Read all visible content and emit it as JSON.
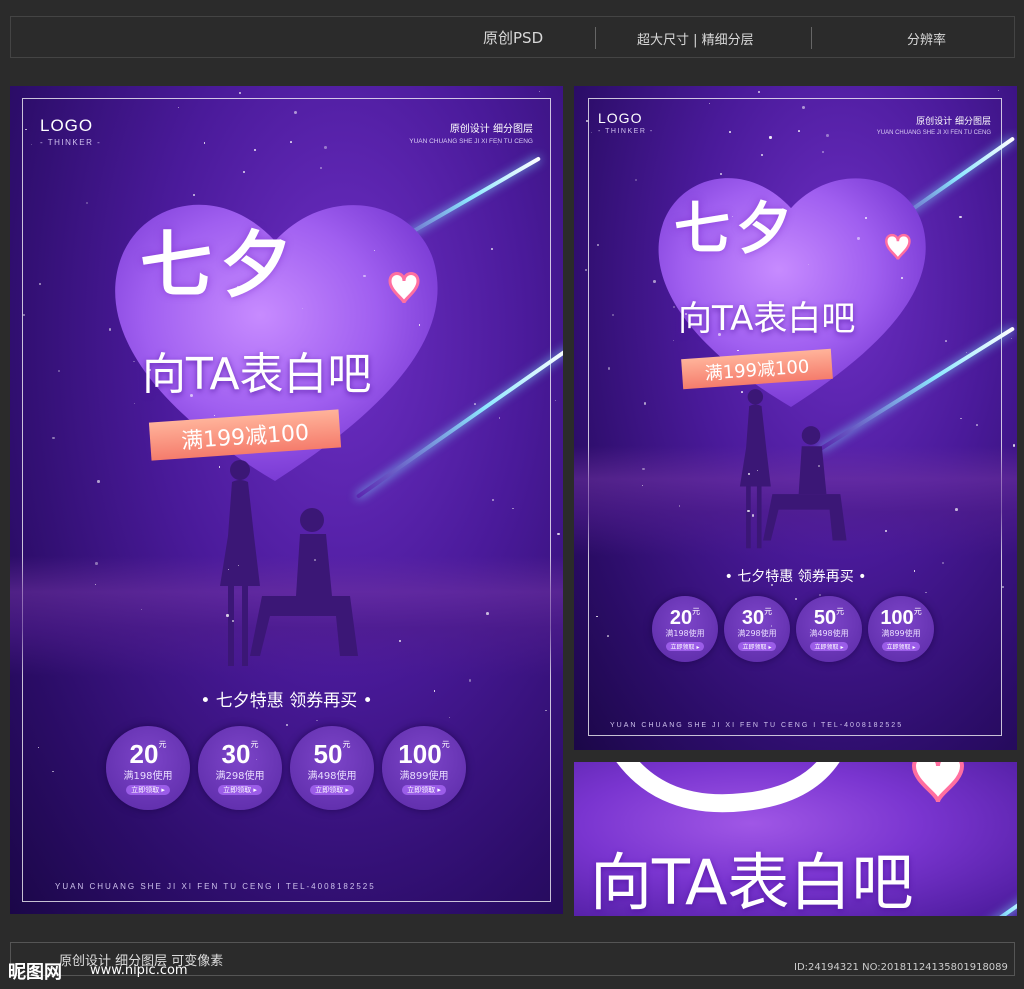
{
  "topbar": {
    "psd": "原创PSD",
    "size": "超大尺寸 | 精细分层",
    "res": "分辨率"
  },
  "poster": {
    "logo": "LOGO",
    "logo_sub": "- THINKER -",
    "tag_cn": "原创设计 细分图层",
    "tag_en": "YUAN CHUANG SHE JI XI FEN TU CENG",
    "title": "七夕",
    "subtitle": "向TA表白吧",
    "ribbon": "满199减100",
    "promo": "• 七夕特惠  领券再买 •",
    "coupons": [
      {
        "value": "20",
        "unit": "元",
        "cond": "满198使用",
        "btn": "立即领取 ▸"
      },
      {
        "value": "30",
        "unit": "元",
        "cond": "满298使用",
        "btn": "立即领取 ▸"
      },
      {
        "value": "50",
        "unit": "元",
        "cond": "满498使用",
        "btn": "立即领取 ▸"
      },
      {
        "value": "100",
        "unit": "元",
        "cond": "满899使用",
        "btn": "立即领取 ▸"
      }
    ],
    "footer": "YUAN CHUANG SHE JI   XI FEN TU CENG   I  TEL-4008182525",
    "footer2": "YUAN CHUANG SHE JI   XI FEN TU CENG   I  TEL-4008182525"
  },
  "bottom": {
    "desc": "原创设计 细分图层 可变像素",
    "watermark": "昵图网",
    "watermark_url": "www.nipic.com",
    "id": "ID:24194321 NO:20181124135801918089"
  },
  "colors": {
    "bg": "#2b2b2b",
    "poster": "#4a1a9a",
    "ribbon": "#f57c6c",
    "accent": "#8ee8ff"
  }
}
